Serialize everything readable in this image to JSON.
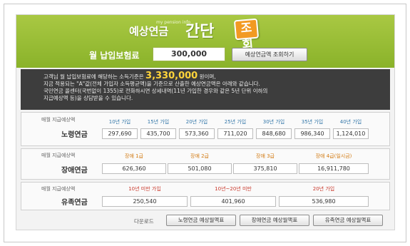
{
  "header": {
    "brand_sub": "my pension info",
    "brand_title": "예상연금",
    "brand_easy": "간단",
    "brand_view": "조회",
    "premium_label": "월 납입보험료",
    "premium_value": "300,000",
    "query_button": "예상연금액 조회하기"
  },
  "info": {
    "line1_pre": "고객님 월 납입보험료에 해당하는 소득기준은",
    "line1_amount": "3,330,000",
    "line1_post": "원이며,",
    "line2": "지금 적용되는 \"A\"값(전체 가입자 소득평균액)을 기준으로 산출한 예상연금액은 아래와 같습니다.",
    "line3": "국민연금 콜센터(국번없이 1355)로 전화하시면 상세내역(11년 가입한 경우와 같은 5년 단위 이하의",
    "line4": "지급예상액 등)을 상담받을 수 있습니다."
  },
  "old_age": {
    "label_small": "매월 지급예상액",
    "label_big": "노령연금",
    "headers": [
      "10년 가입",
      "15년 가입",
      "20년 가입",
      "25년 가입",
      "30년 가입",
      "35년 가입",
      "40년 가입"
    ],
    "values": [
      "297,690",
      "435,700",
      "573,360",
      "711,020",
      "848,680",
      "986,340",
      "1,124,010"
    ]
  },
  "disability": {
    "label_small": "매월 지급예상액",
    "label_big": "장애연금",
    "headers": [
      "장애 1급",
      "장애 2급",
      "장애 3급",
      "장애 4급(일시금)"
    ],
    "values": [
      "626,360",
      "501,080",
      "375,810",
      "16,911,780"
    ]
  },
  "survivor": {
    "label_small": "매월 지급예상액",
    "label_big": "유족연금",
    "headers": [
      "10년 미만 가입",
      "10년~20년 미만",
      "20년 가입"
    ],
    "values": [
      "250,540",
      "401,960",
      "536,980"
    ]
  },
  "footer": {
    "download_label": "다운로드",
    "buttons": [
      "노령연금 예상월액표",
      "장애연금 예상월액표",
      "유족연금 예상월액표"
    ]
  },
  "colors": {
    "header_green": "#8ab32a",
    "accent_orange": "#f29a22",
    "highlight_yellow": "#ffd43a",
    "header_blue": "#3276a8",
    "header_orange": "#d27a12",
    "header_red": "#c8372a"
  }
}
